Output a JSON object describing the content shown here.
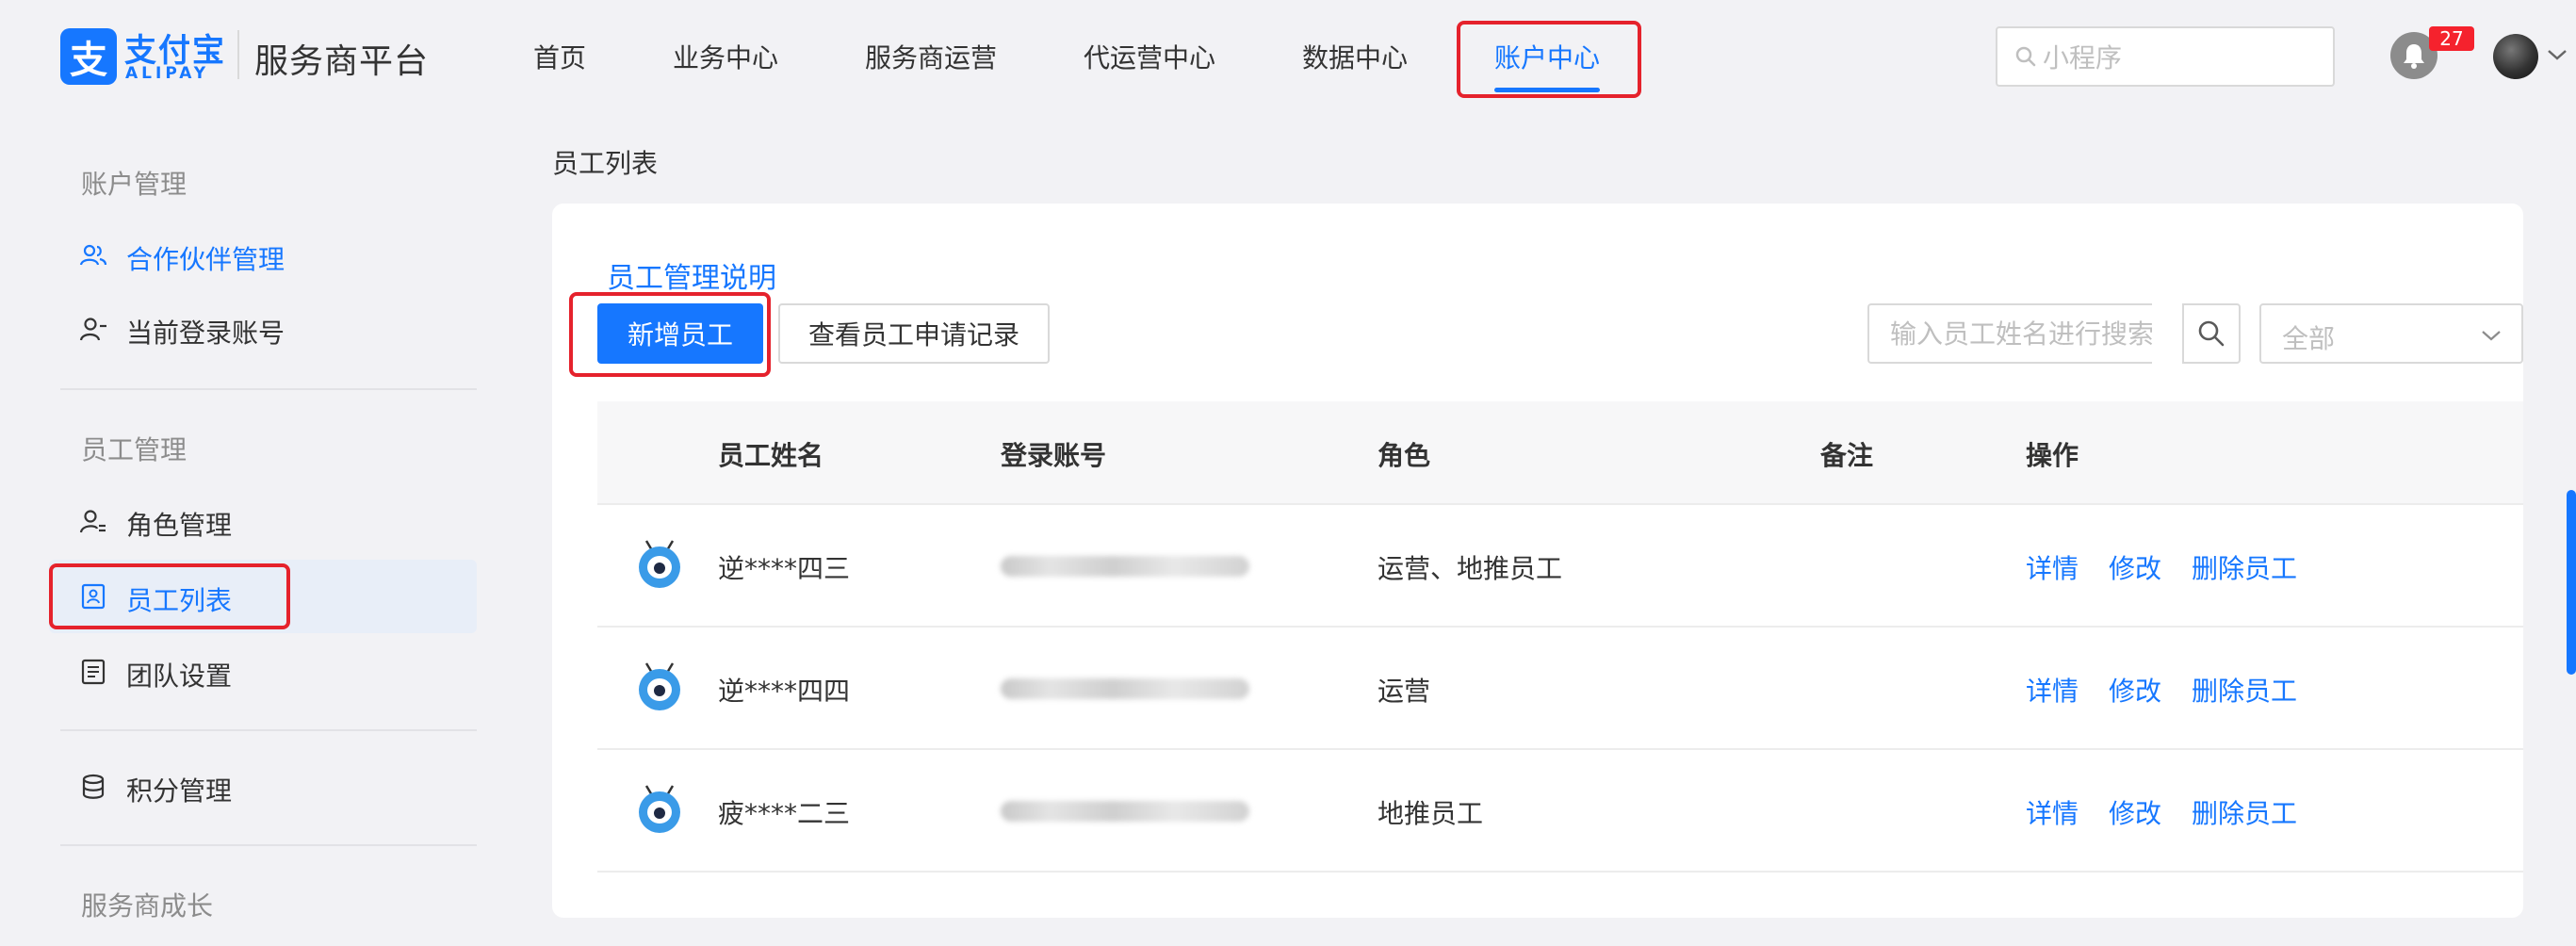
{
  "header": {
    "logo_glyph": "支",
    "logo_cn": "支付宝",
    "logo_en": "ALIPAY",
    "platform_title": "服务商平台",
    "nav": [
      "首页",
      "业务中心",
      "服务商运营",
      "代运营中心",
      "数据中心",
      "账户中心"
    ],
    "active_nav": "账户中心",
    "search_placeholder": "小程序",
    "notification_count": "27",
    "accent_color": "#1677ff"
  },
  "sidebar": {
    "group_account": "账户管理",
    "item_partner": "合作伙伴管理",
    "item_login_account": "当前登录账号",
    "group_staff": "员工管理",
    "item_roles": "角色管理",
    "item_staff_list": "员工列表",
    "item_team": "团队设置",
    "item_points": "积分管理",
    "group_growth": "服务商成长"
  },
  "main": {
    "breadcrumb": "员工列表",
    "help_link": "员工管理说明",
    "add_button": "新增员工",
    "records_button": "查看员工申请记录",
    "search_placeholder": "输入员工姓名进行搜索",
    "filter_value": "全部",
    "columns": {
      "name": "员工姓名",
      "account": "登录账号",
      "role": "角色",
      "remark": "备注",
      "actions": "操作"
    },
    "rows": [
      {
        "name": "逆****四三",
        "role": "运营、地推员工"
      },
      {
        "name": "逆****四四",
        "role": "运营"
      },
      {
        "name": "疲****二三",
        "role": "地推员工"
      }
    ],
    "action_labels": {
      "detail": "详情",
      "edit": "修改",
      "delete": "删除员工"
    }
  }
}
